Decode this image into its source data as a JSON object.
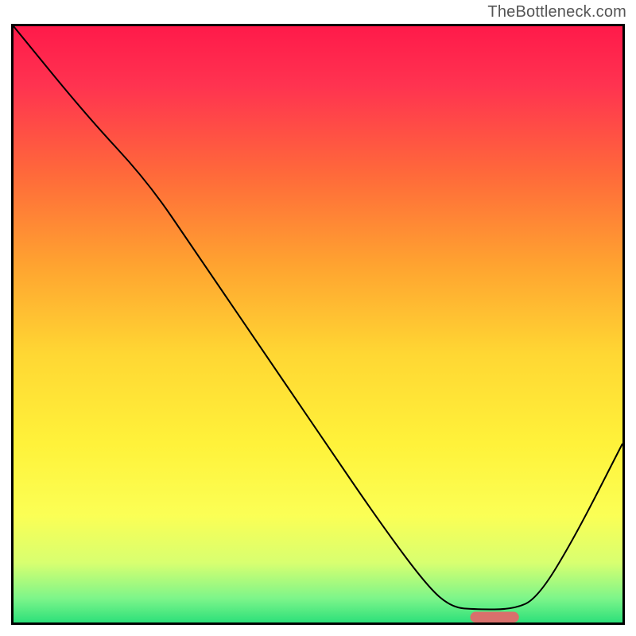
{
  "watermark": "TheBottleneck.com",
  "chart_data": {
    "type": "line",
    "title": "",
    "xlabel": "",
    "ylabel": "",
    "xlim": [
      0,
      100
    ],
    "ylim": [
      0,
      100
    ],
    "background_gradient": [
      {
        "offset": 0.0,
        "color": "#ff1a4a"
      },
      {
        "offset": 0.1,
        "color": "#ff3350"
      },
      {
        "offset": 0.25,
        "color": "#ff6a3a"
      },
      {
        "offset": 0.4,
        "color": "#ffa330"
      },
      {
        "offset": 0.55,
        "color": "#ffd733"
      },
      {
        "offset": 0.7,
        "color": "#fff23a"
      },
      {
        "offset": 0.82,
        "color": "#fbff55"
      },
      {
        "offset": 0.9,
        "color": "#d8ff70"
      },
      {
        "offset": 0.96,
        "color": "#7cf58a"
      },
      {
        "offset": 1.0,
        "color": "#2de07a"
      }
    ],
    "series": [
      {
        "name": "bottleneck-curve",
        "color": "#000000",
        "points": [
          {
            "x": 0,
            "y": 100
          },
          {
            "x": 12,
            "y": 85
          },
          {
            "x": 22,
            "y": 74
          },
          {
            "x": 30,
            "y": 62
          },
          {
            "x": 40,
            "y": 47
          },
          {
            "x": 50,
            "y": 32
          },
          {
            "x": 60,
            "y": 17
          },
          {
            "x": 68,
            "y": 6
          },
          {
            "x": 72,
            "y": 2.5
          },
          {
            "x": 76,
            "y": 2.2
          },
          {
            "x": 82,
            "y": 2.2
          },
          {
            "x": 86,
            "y": 4
          },
          {
            "x": 92,
            "y": 14
          },
          {
            "x": 100,
            "y": 30
          }
        ]
      }
    ],
    "marker": {
      "name": "optimal-range-marker",
      "color": "#d9706c",
      "x_start": 75,
      "x_end": 83,
      "y": 0.9,
      "height": 1.8
    }
  }
}
